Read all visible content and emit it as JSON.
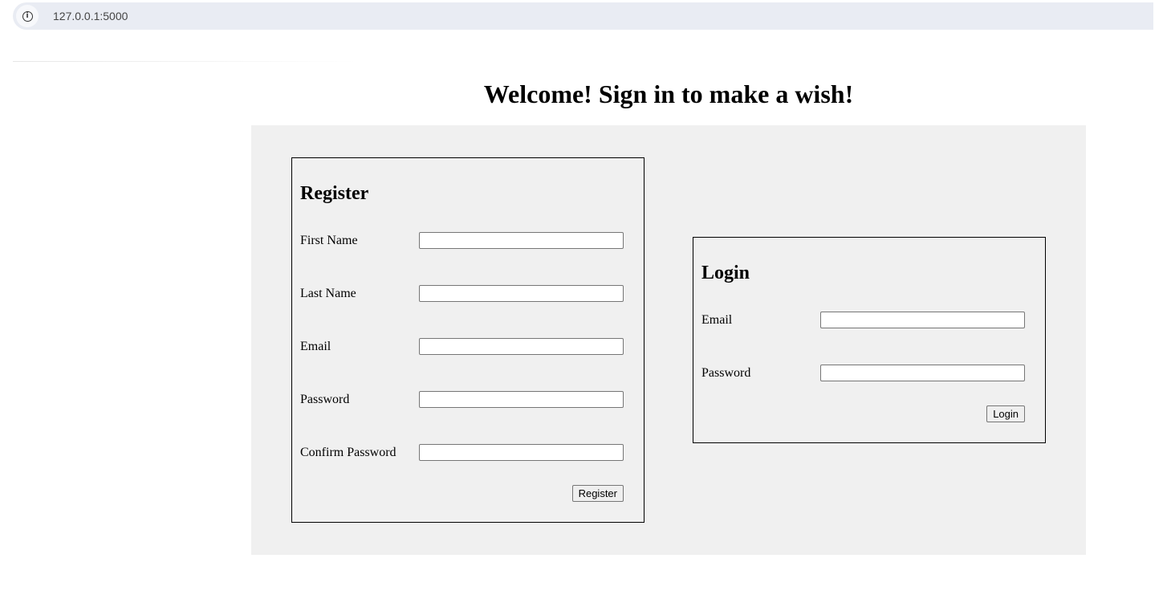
{
  "browser": {
    "url": "127.0.0.1:5000",
    "info_icon": "info-icon"
  },
  "page": {
    "title": "Welcome! Sign in to make a wish!"
  },
  "register": {
    "heading": "Register",
    "fields": [
      {
        "label": "First Name",
        "value": ""
      },
      {
        "label": "Last Name",
        "value": ""
      },
      {
        "label": "Email",
        "value": ""
      },
      {
        "label": "Password",
        "value": ""
      },
      {
        "label": "Confirm Password",
        "value": ""
      }
    ],
    "button_label": "Register"
  },
  "login": {
    "heading": "Login",
    "fields": [
      {
        "label": "Email",
        "value": ""
      },
      {
        "label": "Password",
        "value": ""
      }
    ],
    "button_label": "Login"
  },
  "colors": {
    "panel_background": "#f0f0f0",
    "border": "#000000",
    "url_bar": "#e9ecf3"
  }
}
